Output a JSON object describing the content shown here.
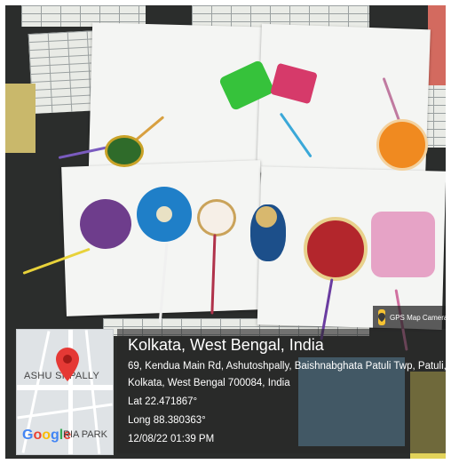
{
  "gps_stamp": {
    "app_name": "GPS Map Camera",
    "city": "Kolkata, West Bengal, India",
    "address_line_1": "69, Kendua Main Rd, Ashutoshpally, Baishnabghata Patuli Twp, Patuli,",
    "address_line_2": "Kolkata, West Bengal 700084, India",
    "latitude": "Lat 22.471867°",
    "longitude": "Long 88.380363°",
    "datetime": "12/08/22 01:39 PM"
  },
  "map": {
    "area_label": "ASHU  SHPALLY",
    "area_label_2": "RIA PARK",
    "brand": [
      "G",
      "o",
      "o",
      "g",
      "l",
      "e"
    ],
    "brand_colors": [
      "#4285F4",
      "#EA4335",
      "#FBBC05",
      "#4285F4",
      "#34A853",
      "#EA4335"
    ],
    "pin_color": "#e53935"
  },
  "colors": {
    "overlay": "#282828",
    "badge_icon": "#f5c232"
  }
}
